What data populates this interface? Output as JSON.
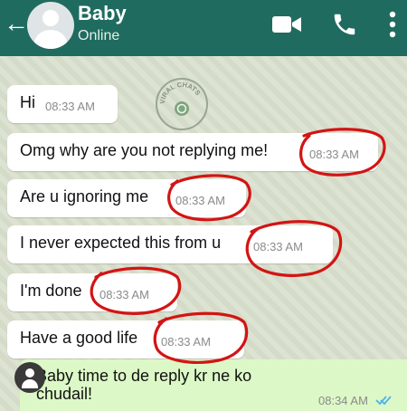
{
  "header": {
    "back_icon": "arrow-left-icon",
    "contact_name": "Baby",
    "status": "Online",
    "icons": [
      "video-call-icon",
      "phone-icon",
      "more-vert-icon"
    ],
    "color": "#1f6b5f"
  },
  "watermark": {
    "label": "VIRAL CHATS"
  },
  "messages": [
    {
      "text": "Hi",
      "time": "08:33 AM"
    },
    {
      "text": "Omg why are you not replying me!",
      "time": "08:33 AM"
    },
    {
      "text": "Are u ignoring me",
      "time": "08:33 AM"
    },
    {
      "text": "I never expected this from u",
      "time": "08:33 AM"
    },
    {
      "text": "I'm done",
      "time": "08:33 AM"
    },
    {
      "text": "Have a good life",
      "time": "08:33 AM"
    }
  ],
  "outgoing": {
    "text": "Baby time to de reply kr ne ko chudail!",
    "time": "08:34 AM",
    "status_icon": "double-check-icon",
    "color": "#dcf8c6"
  },
  "annotation_color": "#d31414"
}
